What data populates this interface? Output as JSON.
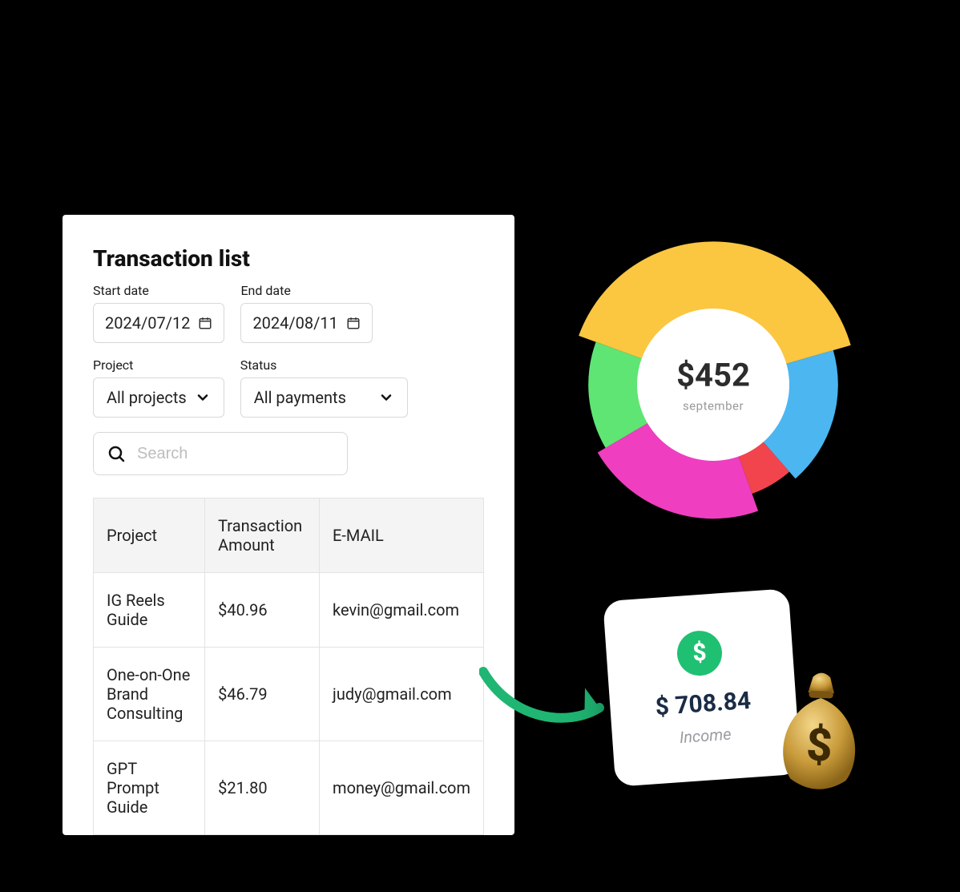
{
  "title": "Transaction list",
  "filters": {
    "start_date": {
      "label": "Start date",
      "value": "2024/07/12"
    },
    "end_date": {
      "label": "End date",
      "value": "2024/08/11"
    },
    "project": {
      "label": "Project",
      "value": "All projects"
    },
    "status": {
      "label": "Status",
      "value": "All payments"
    }
  },
  "search": {
    "placeholder": "Search"
  },
  "table": {
    "columns": [
      "Project",
      "Transaction Amount",
      "E-MAIL"
    ],
    "rows": [
      {
        "project": "IG Reels Guide",
        "amount": "$40.96",
        "email": "kevin@gmail.com"
      },
      {
        "project": "One-on-One Brand Consulting",
        "amount": "$46.79",
        "email": "judy@gmail.com"
      },
      {
        "project": "GPT Prompt Guide",
        "amount": "$21.80",
        "email": "money@gmail.com"
      }
    ]
  },
  "donut": {
    "amount": "$452",
    "period": "september"
  },
  "income_card": {
    "amount": "$ 708.84",
    "label": "Income"
  },
  "colors": {
    "yellow": "#fbc640",
    "blue": "#4cb6f0",
    "red": "#f2444d",
    "magenta": "#ef3ec0",
    "green": "#5fe574"
  },
  "chart_data": {
    "type": "pie",
    "title": "",
    "center_label": "$452",
    "center_sublabel": "september",
    "series": [
      {
        "name": "yellow",
        "value": 40,
        "color": "#fbc640"
      },
      {
        "name": "blue",
        "value": 18,
        "color": "#4cb6f0"
      },
      {
        "name": "red",
        "value": 6,
        "color": "#f2444d"
      },
      {
        "name": "magenta",
        "value": 22,
        "color": "#ef3ec0"
      },
      {
        "name": "green",
        "value": 14,
        "color": "#5fe574"
      }
    ]
  }
}
